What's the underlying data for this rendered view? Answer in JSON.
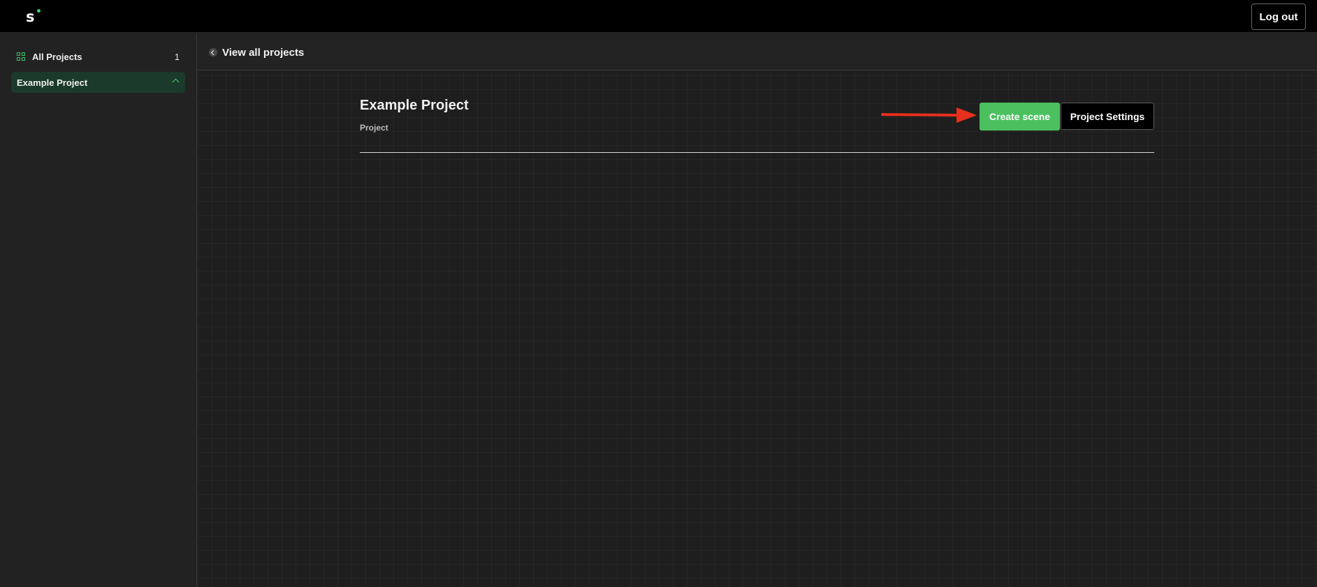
{
  "topbar": {
    "logo_text": "s",
    "logout_label": "Log out"
  },
  "sidebar": {
    "all_projects_label": "All Projects",
    "all_projects_count": "1",
    "items": [
      {
        "label": "Example Project",
        "active": true
      }
    ]
  },
  "breadcrumb": {
    "back_label": "View all projects"
  },
  "project": {
    "title": "Example Project",
    "subtitle": "Project",
    "create_scene_label": "Create scene",
    "settings_label": "Project Settings"
  },
  "colors": {
    "accent": "#3ecf6e",
    "create_button": "#4cc05f",
    "annotation_arrow": "#e8301c",
    "sidebar_active_bg": "#1c3a2b"
  },
  "icons": {
    "grid": "grid-icon",
    "chevron": "chevron-up-icon",
    "back": "chevron-left-circle-icon",
    "arrow": "arrow-right-icon"
  }
}
